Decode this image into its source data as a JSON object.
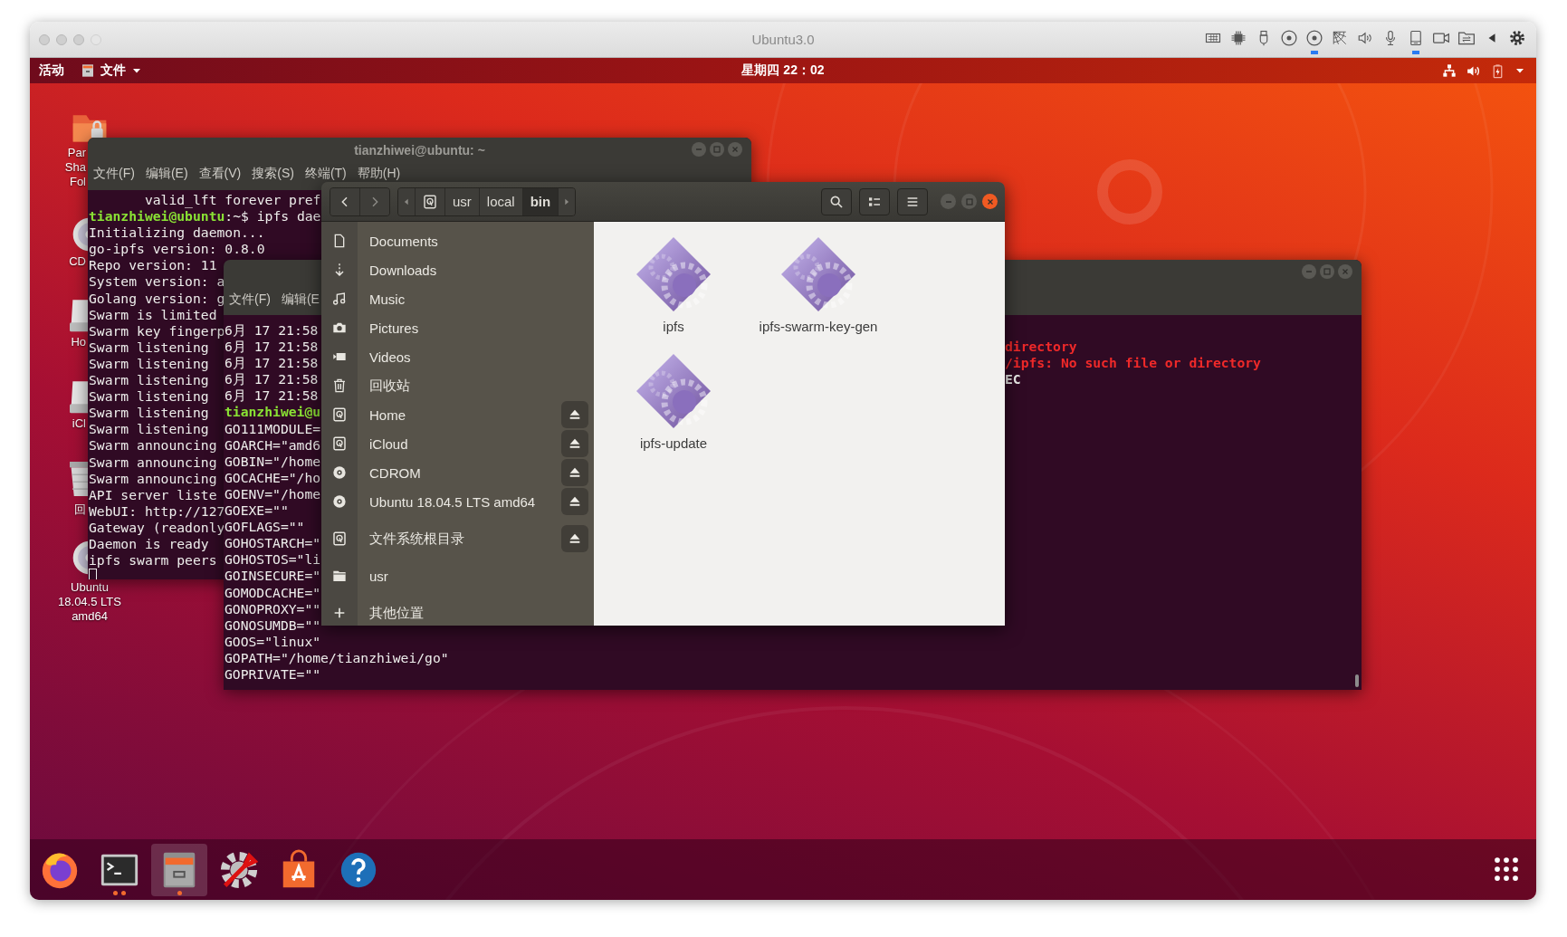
{
  "host_window": {
    "title": "Ubuntu3.0",
    "toolbar": [
      {
        "kind": "keyboard",
        "active": false
      },
      {
        "kind": "chip",
        "active": false
      },
      {
        "kind": "usb",
        "active": false
      },
      {
        "kind": "disc",
        "active": false
      },
      {
        "kind": "disc",
        "active": true
      },
      {
        "kind": "web",
        "active": false
      },
      {
        "kind": "speaker",
        "active": false
      },
      {
        "kind": "mic",
        "active": false
      },
      {
        "kind": "tablet",
        "active": true
      },
      {
        "kind": "camera",
        "active": false
      },
      {
        "kind": "folder",
        "active": false
      },
      {
        "kind": "triangle",
        "active": false
      },
      {
        "kind": "gear",
        "active": false
      }
    ]
  },
  "top_panel": {
    "activities": "活动",
    "app_menu": "文件",
    "clock": "星期四 22：02"
  },
  "desktop_icons": [
    {
      "kind": "shared-folder",
      "label_lines": [
        "Par",
        "Sha",
        "Fol"
      ]
    },
    {
      "kind": "disc",
      "label_lines": [
        "CD"
      ]
    },
    {
      "kind": "drive",
      "label_lines": [
        "Ho"
      ]
    },
    {
      "kind": "drive",
      "label_lines": [
        "iCl"
      ]
    },
    {
      "kind": "trash",
      "label_lines": [
        "回"
      ]
    },
    {
      "kind": "disc",
      "label_lines": [
        "Ubuntu",
        "18.04.5 LTS",
        "amd64"
      ]
    }
  ],
  "terminal_back": {
    "title": "tianzhiwei@ubuntu: ~",
    "menu": [
      "文件(F)",
      "编辑(E)",
      "查看(V)",
      "搜索(S)",
      "终端(T)",
      "帮助(H)"
    ],
    "cursor": true,
    "lines": [
      {
        "text": "       valid_lft forever pref"
      },
      {
        "prompt": "tianzhiwei@ubuntu",
        "text": ":~$ ipfs dae"
      },
      {
        "text": "Initializing daemon..."
      },
      {
        "text": "go-ipfs version: 0.8.0"
      },
      {
        "text": "Repo version: 11"
      },
      {
        "text": "System version: a"
      },
      {
        "text": "Golang version: g"
      },
      {
        "text": "Swarm is limited"
      },
      {
        "text": "Swarm key fingerp"
      },
      {
        "text": "Swarm listening"
      },
      {
        "text": "Swarm listening"
      },
      {
        "text": "Swarm listening"
      },
      {
        "text": "Swarm listening"
      },
      {
        "text": "Swarm listening"
      },
      {
        "text": "Swarm listening"
      },
      {
        "text": "Swarm announcing"
      },
      {
        "text": "Swarm announcing"
      },
      {
        "text": "Swarm announcing"
      },
      {
        "text": "API server liste"
      },
      {
        "text": "WebUI: http://127"
      },
      {
        "text": "Gateway (readonly"
      },
      {
        "text": "Daemon is ready"
      },
      {
        "text": "ipfs swarm peers"
      }
    ]
  },
  "terminal_front": {
    "menu": [
      "文件(F)",
      "编辑(E"
    ],
    "lines": [
      {
        "text": "6月 17 21:58"
      },
      {
        "text": "6月 17 21:58",
        "right": {
          "text": "directory",
          "error": true
        }
      },
      {
        "text": "6月 17 21:58",
        "right": {
          "text": "/ipfs: No such file or directory",
          "error": true
        }
      },
      {
        "text": "6月 17 21:58",
        "right": {
          "text": "EC",
          "error": false
        }
      },
      {
        "text": "6月 17 21:58"
      },
      {
        "prompt": "tianzhiwei@u"
      },
      {
        "text": "GO111MODULE="
      },
      {
        "text": "GOARCH=\"amd6"
      },
      {
        "text": "GOBIN=\"/home"
      },
      {
        "text": "GOCACHE=\"/ho"
      },
      {
        "text": "GOENV=\"/home"
      },
      {
        "text": "GOEXE=\"\""
      },
      {
        "text": "GOFLAGS=\"\""
      },
      {
        "text": "GOHOSTARCH=\""
      },
      {
        "text": "GOHOSTOS=\"li"
      },
      {
        "text": "GOINSECURE=\""
      },
      {
        "text": "GOMODCACHE=\""
      },
      {
        "text": "GONOPROXY=\"\""
      },
      {
        "text": "GONOSUMDB=\"\""
      },
      {
        "text": "GOOS=\"linux\""
      },
      {
        "text": "GOPATH=\"/home/tianzhiwei/go\""
      },
      {
        "text": "GOPRIVATE=\"\""
      }
    ]
  },
  "file_manager": {
    "path": [
      {
        "label": "usr",
        "selected": false
      },
      {
        "label": "local",
        "selected": false
      },
      {
        "label": "bin",
        "selected": true
      }
    ],
    "sidebar": [
      {
        "items": [
          {
            "kind": "documents",
            "label": "Documents",
            "ejectable": false
          },
          {
            "kind": "downloads",
            "label": "Downloads",
            "ejectable": false
          },
          {
            "kind": "music",
            "label": "Music",
            "ejectable": false
          },
          {
            "kind": "pictures",
            "label": "Pictures",
            "ejectable": false
          },
          {
            "kind": "videos",
            "label": "Videos",
            "ejectable": false
          },
          {
            "kind": "trash",
            "label": "回收站",
            "ejectable": false
          },
          {
            "kind": "drive",
            "label": "Home",
            "ejectable": true
          },
          {
            "kind": "drive",
            "label": "iCloud",
            "ejectable": true
          },
          {
            "kind": "disc",
            "label": "CDROM",
            "ejectable": true
          },
          {
            "kind": "disc",
            "label": "Ubuntu 18.04.5 LTS amd64",
            "ejectable": true
          }
        ]
      },
      {
        "items": [
          {
            "kind": "drive",
            "label": "文件系统根目录",
            "ejectable": true
          }
        ]
      },
      {
        "items": [
          {
            "kind": "folder",
            "label": "usr",
            "ejectable": false
          }
        ]
      },
      {
        "items": [
          {
            "kind": "other",
            "label": "其他位置",
            "ejectable": false
          }
        ]
      }
    ],
    "files": [
      {
        "name": "ipfs"
      },
      {
        "name": "ipfs-swarm-key-gen"
      },
      {
        "name": "ipfs-update"
      }
    ]
  },
  "dock": [
    {
      "kind": "browser",
      "running": false,
      "multiple": false,
      "selected": false
    },
    {
      "kind": "terminal",
      "running": true,
      "multiple": true,
      "selected": false
    },
    {
      "kind": "files",
      "running": true,
      "multiple": false,
      "selected": true
    },
    {
      "kind": "tools",
      "running": false,
      "multiple": false,
      "selected": false
    },
    {
      "kind": "store",
      "running": false,
      "multiple": false,
      "selected": false
    },
    {
      "kind": "help",
      "running": false,
      "multiple": false,
      "selected": false
    }
  ]
}
